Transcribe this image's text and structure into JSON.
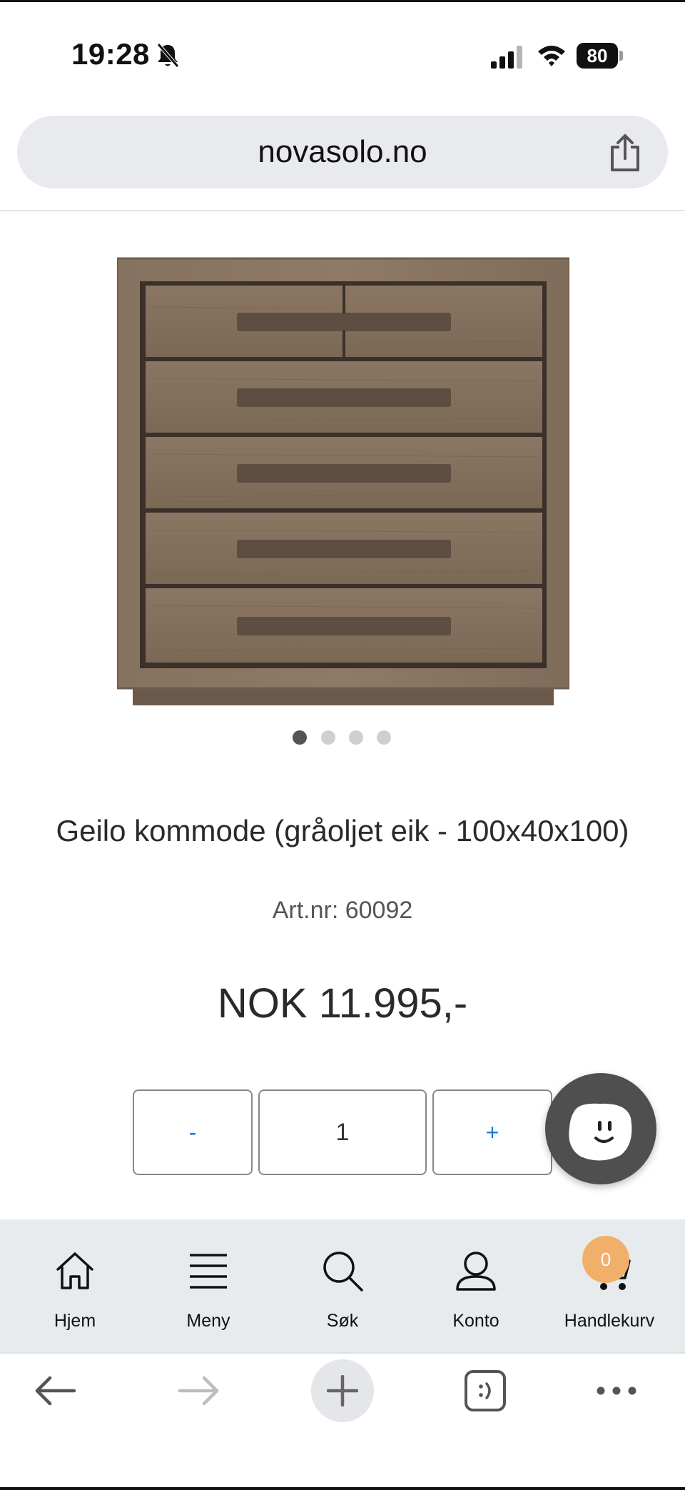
{
  "status_bar": {
    "time": "19:28",
    "battery": "80",
    "icons": [
      "bell-slash-icon",
      "cellular-signal-icon",
      "wifi-icon",
      "battery-icon"
    ]
  },
  "browser": {
    "url": "novasolo.no",
    "share_icon": "share-icon"
  },
  "product": {
    "image_description_icon": "dresser-image",
    "carousel": {
      "total": 4,
      "active": 1
    },
    "title": "Geilo kommode (gråoljet eik - 100x40x100)",
    "article_number": "Art.nr: 60092",
    "price": "NOK 11.995,-"
  },
  "quantity": {
    "minus_label": "-",
    "value": "1",
    "plus_label": "+"
  },
  "chat": {
    "icon": "chat-smiley-icon"
  },
  "bottom_nav": {
    "items": [
      {
        "label": "Hjem",
        "icon": "home-icon"
      },
      {
        "label": "Meny",
        "icon": "menu-icon"
      },
      {
        "label": "Søk",
        "icon": "search-icon"
      },
      {
        "label": "Konto",
        "icon": "account-icon"
      },
      {
        "label": "Handlekurv",
        "icon": "cart-icon"
      }
    ],
    "cart_count": "0"
  },
  "browser_toolbar": {
    "icons": [
      "back-arrow-icon",
      "forward-arrow-icon",
      "new-tab-icon",
      "tabs-icon",
      "more-icon"
    ]
  },
  "colors": {
    "accent_blue": "#1a7ad9",
    "badge_orange": "#f1b06a",
    "nav_background": "#e8ebee",
    "chat_background": "#4f4f4f"
  }
}
